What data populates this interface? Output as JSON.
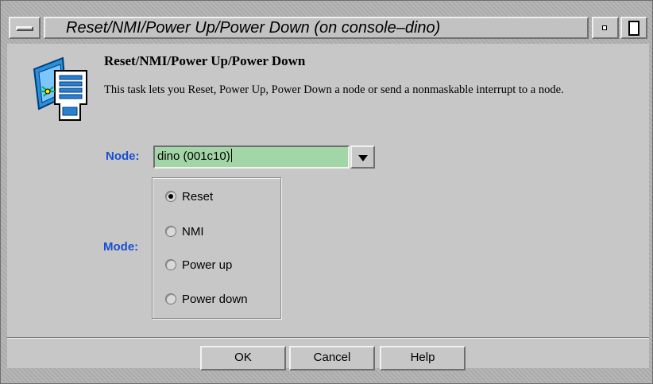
{
  "window": {
    "title": "Reset/NMI/Power Up/Power Down (on console–dino)"
  },
  "task": {
    "title": "Reset/NMI/Power Up/Power Down",
    "description": "This task lets you Reset, Power Up, Power Down a node or send a nonmaskable interrupt to a node."
  },
  "node": {
    "label": "Node:",
    "value": "dino (001c10)"
  },
  "mode": {
    "label": "Mode:",
    "options": [
      {
        "label": "Reset",
        "selected": true
      },
      {
        "label": "NMI",
        "selected": false
      },
      {
        "label": "Power up",
        "selected": false
      },
      {
        "label": "Power down",
        "selected": false
      }
    ]
  },
  "buttons": {
    "ok": "OK",
    "cancel": "Cancel",
    "help": "Help"
  },
  "colors": {
    "label_accent": "#1a4fd0",
    "field_bg": "#a3d6a6",
    "panel_bg": "#c7c7c7"
  }
}
